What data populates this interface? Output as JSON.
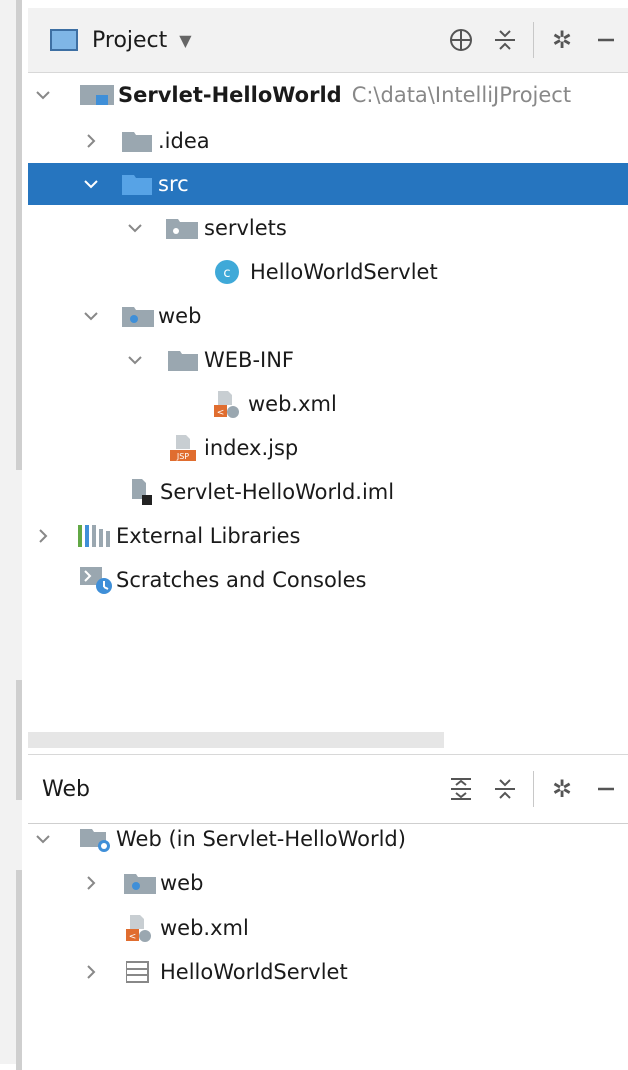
{
  "project_panel": {
    "title": "Project",
    "tree": {
      "root_name": "Servlet-HelloWorld",
      "root_path": "C:\\data\\IntelliJProject",
      "idea": ".idea",
      "src": "src",
      "servlets": "servlets",
      "servlet_class": "HelloWorldServlet",
      "web": "web",
      "web_inf": "WEB-INF",
      "web_xml": "web.xml",
      "index_jsp": "index.jsp",
      "iml": "Servlet-HelloWorld.iml",
      "external_libraries": "External Libraries",
      "scratches": "Scratches and Consoles"
    }
  },
  "web_panel": {
    "title": "Web",
    "tree": {
      "root": "Web (in Servlet-HelloWorld)",
      "web": "web",
      "web_xml": "web.xml",
      "servlet": "HelloWorldServlet"
    }
  },
  "icons": {
    "project_window": "project-window-icon",
    "target": "locate-icon",
    "collapse": "collapse-all-icon",
    "expand": "expand-all-icon",
    "settings": "gear-icon",
    "hide": "minimize-icon"
  },
  "colors": {
    "selection": "#2675bf",
    "folder": "#9aa7b0",
    "source_folder": "#3f8fd8",
    "class_circle": "#3fa9d8",
    "xml_orange": "#e06d2f"
  }
}
